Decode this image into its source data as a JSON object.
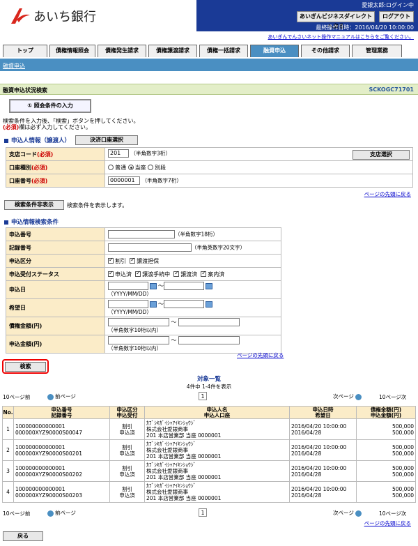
{
  "header": {
    "bank_name": "あいち銀行",
    "user_status": "愛銀太郎:ログイン中",
    "direct_button": "あいぎんビジネスダイレクトへ戻る",
    "logout_button": "ログアウト",
    "last_operation": "最終操作日時：2016/04/20 10:00:00",
    "manual_link": "あいぎんでんさいネット操作マニュアルはこちらをご覧ください。"
  },
  "tabs": [
    "トップ",
    "債権情報照会",
    "債権発生請求",
    "債権譲渡請求",
    "債権一括請求",
    "融資申込",
    "その他請求",
    "管理業務"
  ],
  "subnav": "融資申込",
  "page": {
    "title": "融資申込状況検索",
    "screen_id": "SCKOGC71701",
    "step_label": "① 照会条件の入力",
    "note_line1": "検索条件を入力後、「検索」ボタンを押してください。",
    "note_req": "(必須)",
    "note_line2": "欄は必ず入力してください。"
  },
  "applicant": {
    "section_title": "申込人情報（譲渡人）",
    "settle_button": "決済口座選択",
    "branch_label": "支店コード",
    "branch_req": "(必須)",
    "branch_value": "201",
    "branch_hint": "（半角数字3桁）",
    "branch_button": "支店選択",
    "type_label": "口座種別",
    "type_req": "(必須)",
    "type_opt1": "普通",
    "type_opt2": "当座",
    "type_opt3": "別段",
    "account_label": "口座番号",
    "account_req": "(必須)",
    "account_value": "0000001",
    "account_hint": "（半角数字7桁）"
  },
  "page_top_link": "ページの先頭に戻る",
  "toggle_button": "検索条件非表示",
  "toggle_note": "検索条件を表示します。",
  "criteria": {
    "section_title": "申込情報検索条件",
    "row1_label": "申込番号",
    "row1_hint": "（半角数字18桁）",
    "row2_label": "記録番号",
    "row2_hint": "（半角英数字20文字）",
    "row3_label": "申込区分",
    "row3_opt1": "割引",
    "row3_opt2": "譲渡担保",
    "row4_label": "申込受付ステータス",
    "row4_opt1": "申込済",
    "row4_opt2": "譲渡手続中",
    "row4_opt3": "譲渡済",
    "row4_opt4": "案内済",
    "row5_label": "申込日",
    "date_hint": "（YYYY/MM/DD）",
    "row6_label": "希望日",
    "row7_label": "債権金額(円)",
    "amount_hint": "（半角数字10桁以内）",
    "row8_label": "申込金額(円)",
    "tilde": "～"
  },
  "search_button": "検索",
  "results": {
    "title": "対象一覧",
    "count": "4件中 1-4件を表示",
    "prev10": "10ページ前",
    "prev": "前ページ",
    "page": "1",
    "next": "次ページ",
    "next10": "10ページ次",
    "headers": {
      "no": "No.",
      "h1a": "申込番号",
      "h1b": "記録番号",
      "h2a": "申込区分",
      "h2b": "申込受付",
      "h3a": "申込人名",
      "h3b": "申込人口座",
      "h4a": "申込日時",
      "h4b": "希望日",
      "h5a": "債権金額(円)",
      "h5b": "申込金額(円)"
    },
    "rows": [
      {
        "no": "1",
        "app_no": "100000000000001",
        "rec_no": "000000XYZ90000S00047",
        "kind": "割引",
        "status": "申込済",
        "name_kana": "ｶﾌﾞｼｷｶﾞｲｼｬｱｲｷﾝｼｮｳｼﾞ",
        "name": "株式会社愛銀商事",
        "account": "201 本店営業部 当座 0000001",
        "date": "2016/04/20 10:00:00",
        "wish": "2016/04/28",
        "amount": "500,000",
        "apply_amount": "500,000"
      },
      {
        "no": "2",
        "app_no": "100000000000001",
        "rec_no": "000000XYZ90000S00201",
        "kind": "割引",
        "status": "申込済",
        "name_kana": "ｶﾌﾞｼｷｶﾞｲｼｬｱｲｷﾝｼｮｳｼﾞ",
        "name": "株式会社愛銀商事",
        "account": "201 本店営業部 当座 0000001",
        "date": "2016/04/20 10:00:00",
        "wish": "2016/04/28",
        "amount": "500,000",
        "apply_amount": "500,000"
      },
      {
        "no": "3",
        "app_no": "100000000000001",
        "rec_no": "000000XYZ90000S00202",
        "kind": "割引",
        "status": "申込済",
        "name_kana": "ｶﾌﾞｼｷｶﾞｲｼｬｱｲｷﾝｼｮｳｼﾞ",
        "name": "株式会社愛銀商事",
        "account": "201 本店営業部 当座 0000001",
        "date": "2016/04/20 10:00:00",
        "wish": "2016/04/28",
        "amount": "500,000",
        "apply_amount": "500,000"
      },
      {
        "no": "4",
        "app_no": "100000000000001",
        "rec_no": "000000XYZ90000S00203",
        "kind": "割引",
        "status": "申込済",
        "name_kana": "ｶﾌﾞｼｷｶﾞｲｼｬｱｲｷﾝｼｮｳｼﾞ",
        "name": "株式会社愛銀商事",
        "account": "201 本店営業部 当座 0000001",
        "date": "2016/04/20 10:00:00",
        "wish": "2016/04/28",
        "amount": "500,000",
        "apply_amount": "500,000"
      }
    ]
  },
  "back_button": "戻る",
  "colors": {
    "header_blue": "#1a3a96",
    "tab_active": "#4a8fc2",
    "label_bg": "#fbecc8",
    "highlight": "#e00000"
  }
}
